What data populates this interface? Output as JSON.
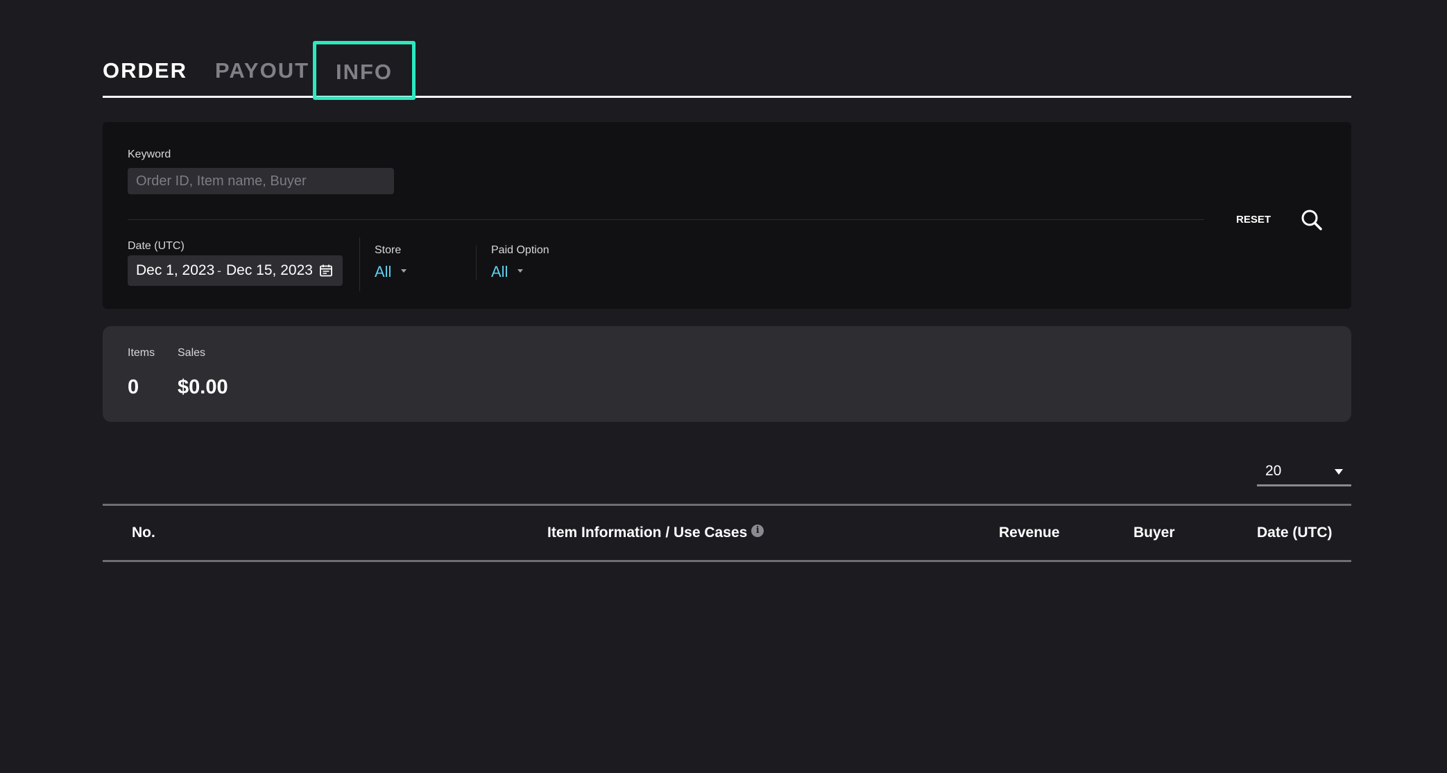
{
  "tabs": [
    {
      "label": "ORDER",
      "active": true
    },
    {
      "label": "PAYOUT",
      "active": false
    },
    {
      "label": "INFO",
      "active": false,
      "highlighted": true
    }
  ],
  "filters": {
    "keyword_label": "Keyword",
    "keyword_placeholder": "Order ID, Item name, Buyer",
    "keyword_value": "",
    "date_label": "Date (UTC)",
    "date_start": "Dec 1, 2023",
    "date_separator": "-",
    "date_end": "Dec 15, 2023",
    "store_label": "Store",
    "store_value": "All",
    "paid_label": "Paid Option",
    "paid_value": "All",
    "reset_label": "RESET",
    "search_icon": "search-icon",
    "calendar_icon": "calendar-icon"
  },
  "summary": {
    "items_label": "Items",
    "items_value": "0",
    "sales_label": "Sales",
    "sales_value": "$0.00"
  },
  "page_size": {
    "value": "20"
  },
  "table": {
    "columns": [
      {
        "label": "No."
      },
      {
        "label": "Item Information / Use Cases",
        "info_icon": true
      },
      {
        "label": "Revenue"
      },
      {
        "label": "Buyer"
      },
      {
        "label": "Date (UTC)"
      }
    ],
    "rows": []
  },
  "colors": {
    "background": "#1c1b20",
    "panel": "#111113",
    "summary_panel": "#2e2d32",
    "accent_highlight": "#2de8c0",
    "select_value": "#5fd0ee"
  }
}
